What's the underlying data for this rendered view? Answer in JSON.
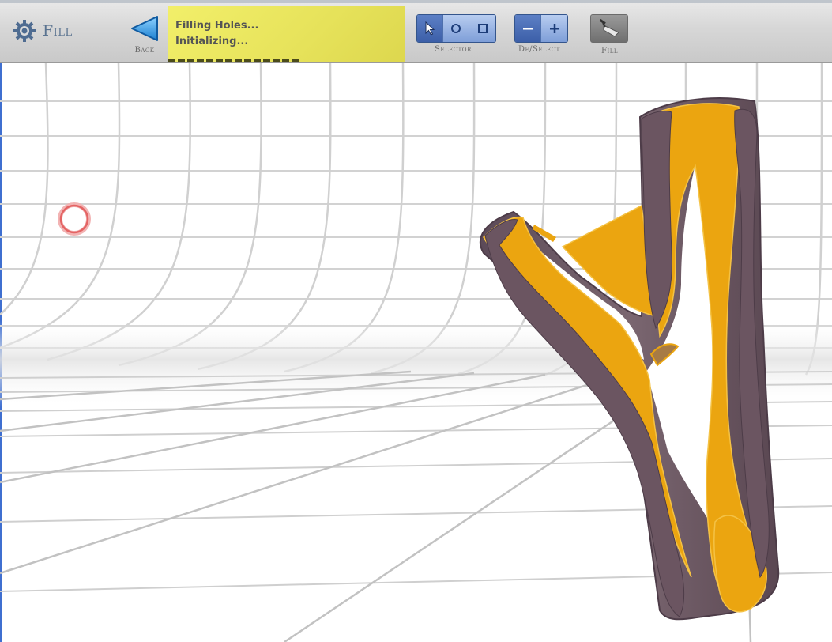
{
  "toolbar": {
    "mode_label": "Fill",
    "back_label": "Back",
    "status_line1": "Filling Holes...",
    "status_line2": "Initializing...",
    "status_progress": 0.55,
    "selector_label": "Selector",
    "deselect_label": "De/Select",
    "fill_label": "Fill"
  },
  "icons": {
    "mode": "gear-icon",
    "back": "triangle-left-icon",
    "selector_pointer": "cursor-arrow-icon",
    "selector_circle": "circle-select-icon",
    "selector_rect": "square-select-icon",
    "minus": "minus-icon",
    "plus": "plus-icon",
    "fill": "trowel-icon",
    "cursor": "circle-cursor-icon"
  },
  "colors": {
    "accent_blue": "#2f9be6",
    "status_yellow": "#e6e25a",
    "fill_orange": "#eba510",
    "wood_brown": "#6b5560",
    "cursor_red": "#e66a6a"
  }
}
